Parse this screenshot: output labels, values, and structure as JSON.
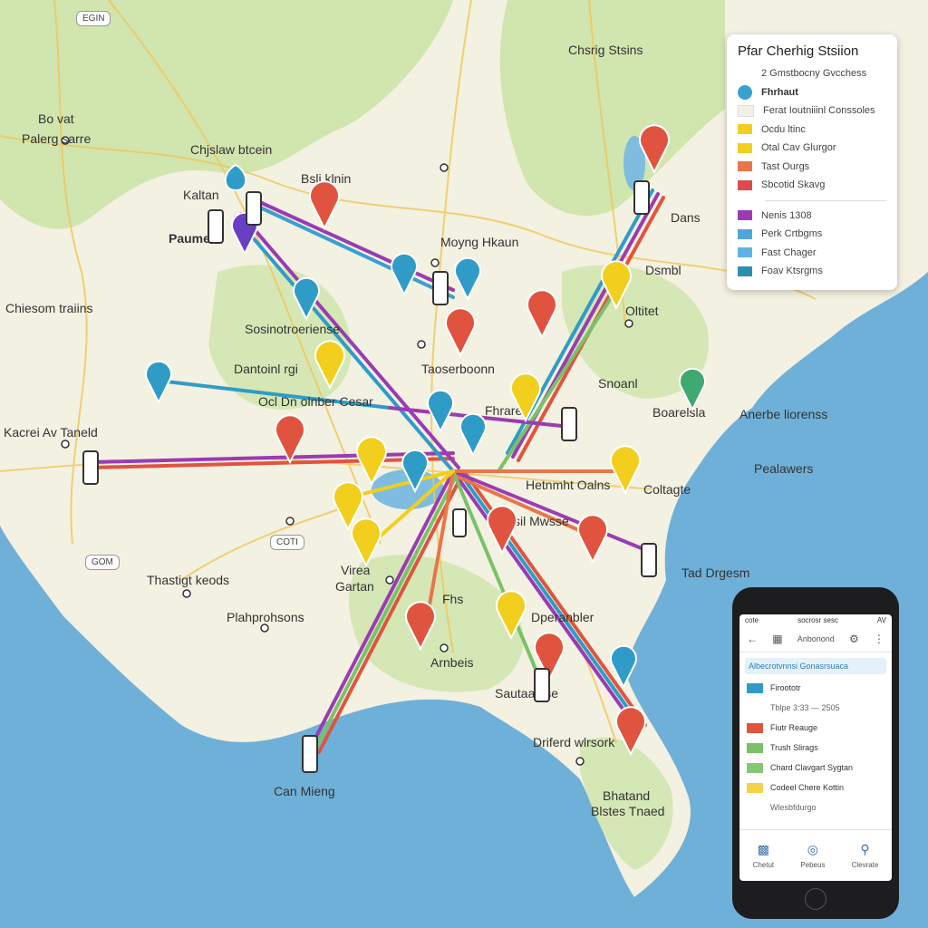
{
  "legend": {
    "title": "Pfar Cherhig Stsiion",
    "items": [
      {
        "label": "2 Gmstbocny Gvcchess",
        "color": "",
        "shape": "none"
      },
      {
        "label": "Fhrhaut",
        "color": "#3aa0d0",
        "shape": "circle"
      },
      {
        "label": "Ferat Ioutniiinl Conssoles",
        "color": "#f1f1e4",
        "shape": "rect"
      },
      {
        "label": "Ocdu ltinc",
        "color": "#f2cf1d",
        "shape": "rect"
      },
      {
        "label": "Otal Cav Glurgor",
        "color": "#f2cf1d",
        "shape": "rect"
      },
      {
        "label": "Tast Ourgs",
        "color": "#e8764a",
        "shape": "rect"
      },
      {
        "label": "Sbcotid Skavg",
        "color": "#e04a4a",
        "shape": "rect"
      }
    ],
    "items2": [
      {
        "label": "Nenis  1308",
        "color": "#9b3bb3"
      },
      {
        "label": "Perk Crtbgms",
        "color": "#4fa6dc"
      },
      {
        "label": "Fast Chager",
        "color": "#5fb2e6"
      },
      {
        "label": "Foav Ktsrgms",
        "color": "#2b8fb0"
      }
    ]
  },
  "map_labels": [
    {
      "text": "Chsrig Stsins"
    },
    {
      "text": "Bo vat"
    },
    {
      "text": "Palerg sarre"
    },
    {
      "text": "Chjslaw btcein"
    },
    {
      "text": "Bsli klnin"
    },
    {
      "text": "Kaltan"
    },
    {
      "text": "Paumeli"
    },
    {
      "text": "Moyng Hkaun"
    },
    {
      "text": "Chiesom traiins"
    },
    {
      "text": "Sosinotroeriense"
    },
    {
      "text": "Dantoinl rgi"
    },
    {
      "text": "Kacrei Av Taneld"
    },
    {
      "text": "Ocl Dn olnber Cesar"
    },
    {
      "text": "Taoserboonn"
    },
    {
      "text": "Fhrarer"
    },
    {
      "text": "Snoanl"
    },
    {
      "text": "Boarelsla"
    },
    {
      "text": "Anerbe liorenss"
    },
    {
      "text": "Pealawers"
    },
    {
      "text": "Hetnmht Oalns"
    },
    {
      "text": "Tsil Mwsse"
    },
    {
      "text": "Tad Drgesm"
    },
    {
      "text": "Thastigt keods"
    },
    {
      "text": "Plahprohsons"
    },
    {
      "text": "Virea"
    },
    {
      "text": "Gartan"
    },
    {
      "text": "Dperanbler"
    },
    {
      "text": "Arnbeis"
    },
    {
      "text": "Sautaalnse"
    },
    {
      "text": "Driferd wlrsork"
    },
    {
      "text": "Bhatand"
    },
    {
      "text": "Blstes Tnaed"
    },
    {
      "text": "Can Mieng"
    },
    {
      "text": "Fhs"
    },
    {
      "text": "Dsmbl"
    },
    {
      "text": "Dans"
    },
    {
      "text": "Oltitet"
    },
    {
      "text": "Coltagte"
    }
  ],
  "shields": [
    {
      "text": "EGIN"
    },
    {
      "text": "COTI"
    },
    {
      "text": "GOM"
    }
  ],
  "phone": {
    "status_left": "cote",
    "status_mid": "socrosr sesc",
    "status_right": "AV",
    "nav_title": "Anbonond",
    "banner": "Albecrotvnnsi  Gonasrsuaca",
    "items": [
      {
        "label": "Firoototr",
        "color": "#2e9cc7"
      },
      {
        "label": "Tblpe 3:33 — 2505",
        "color": ""
      },
      {
        "label": "Fiutr Reauge",
        "color": "#e0543f"
      },
      {
        "label": "Trush Slirags",
        "color": "#79c269"
      },
      {
        "label": "Chard Clavgart Sygtan",
        "color": "#86c776"
      },
      {
        "label": "Codeel Chere Kottin",
        "color": "#f6d24c"
      },
      {
        "label": "Wlesbfdurgo",
        "color": ""
      }
    ],
    "tabs": [
      {
        "label": "Chetut",
        "icon": "charger-icon"
      },
      {
        "label": "Pebeus",
        "icon": "target-icon"
      },
      {
        "label": "Clevrate",
        "icon": "location-icon"
      }
    ]
  }
}
